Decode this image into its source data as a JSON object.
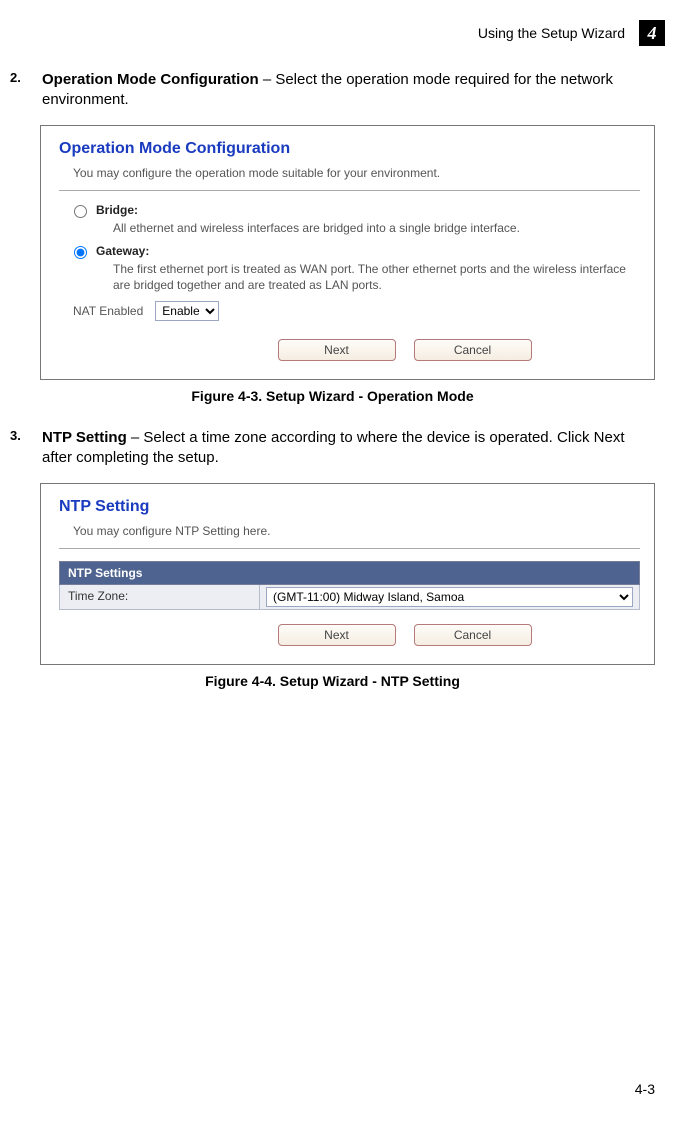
{
  "header": {
    "section_title": "Using the Setup Wizard",
    "chapter_num": "4"
  },
  "step2": {
    "num": "2.",
    "title": "Operation Mode Configuration",
    "rest": " – Select the operation mode required for the network environment."
  },
  "fig1": {
    "heading": "Operation Mode Configuration",
    "desc": "You may configure the operation mode suitable for your environment.",
    "bridge_label": "Bridge:",
    "bridge_desc": "All ethernet and wireless interfaces are bridged into a single bridge interface.",
    "gateway_label": "Gateway:",
    "gateway_desc": "The first ethernet port is treated as WAN port. The other ethernet ports and the wireless interface are bridged together and are treated as LAN ports.",
    "nat_label": "NAT Enabled",
    "nat_value": "Enable",
    "next_btn": "Next",
    "cancel_btn": "Cancel",
    "caption": "Figure 4-3.   Setup Wizard - Operation Mode"
  },
  "step3": {
    "num": "3.",
    "title": "NTP Setting",
    "rest": " – Select a time zone according to where the device is operated. Click Next after completing the setup."
  },
  "fig2": {
    "heading": "NTP Setting",
    "desc": "You may configure NTP Setting here.",
    "table_head": "NTP Settings",
    "tz_label": "Time Zone:",
    "tz_value": "(GMT-11:00) Midway Island, Samoa",
    "next_btn": "Next",
    "cancel_btn": "Cancel",
    "caption": "Figure 4-4.   Setup Wizard - NTP Setting"
  },
  "page_num": "4-3"
}
